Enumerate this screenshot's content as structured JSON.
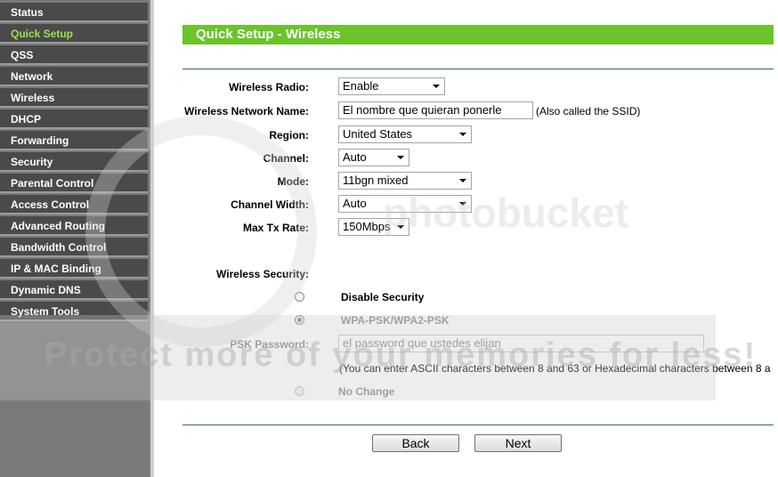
{
  "sidebar": {
    "items": [
      {
        "label": "Status"
      },
      {
        "label": "Quick Setup",
        "active": true
      },
      {
        "label": "QSS"
      },
      {
        "label": "Network"
      },
      {
        "label": "Wireless"
      },
      {
        "label": "DHCP"
      },
      {
        "label": "Forwarding"
      },
      {
        "label": "Security"
      },
      {
        "label": "Parental Control"
      },
      {
        "label": "Access Control"
      },
      {
        "label": "Advanced Routing"
      },
      {
        "label": "Bandwidth Control"
      },
      {
        "label": "IP & MAC Binding"
      },
      {
        "label": "Dynamic DNS"
      },
      {
        "label": "System Tools"
      }
    ]
  },
  "header": {
    "title": "Quick Setup - Wireless"
  },
  "form": {
    "wireless_radio": {
      "label": "Wireless Radio:",
      "value": "Enable"
    },
    "network_name": {
      "label": "Wireless Network Name:",
      "value": "El nombre que quieran ponerle",
      "hint": "(Also called the SSID)"
    },
    "region": {
      "label": "Region:",
      "value": "United States"
    },
    "channel": {
      "label": "Channel:",
      "value": "Auto"
    },
    "mode": {
      "label": "Mode:",
      "value": "11bgn mixed"
    },
    "channel_width": {
      "label": "Channel Width:",
      "value": "Auto"
    },
    "max_tx_rate": {
      "label": "Max Tx Rate:",
      "value": "150Mbps"
    }
  },
  "security": {
    "label": "Wireless Security:",
    "disable_label": "Disable Security",
    "wpa_label": "WPA-PSK/WPA2-PSK",
    "psk_label": "PSK Password:",
    "psk_value": "el password que ustedes elijan",
    "psk_hint": "(You can enter ASCII characters between 8 and 63 or Hexadecimal characters between 8 a",
    "no_change_label": "No Change"
  },
  "buttons": {
    "back": "Back",
    "next": "Next"
  },
  "watermark": {
    "text": "Protect more of your memories for less!",
    "brand": "photobucket"
  },
  "colors": {
    "accent": "#6ac42a",
    "sidebar_bg": "#4a4a4a",
    "active_text": "#9be34a"
  }
}
